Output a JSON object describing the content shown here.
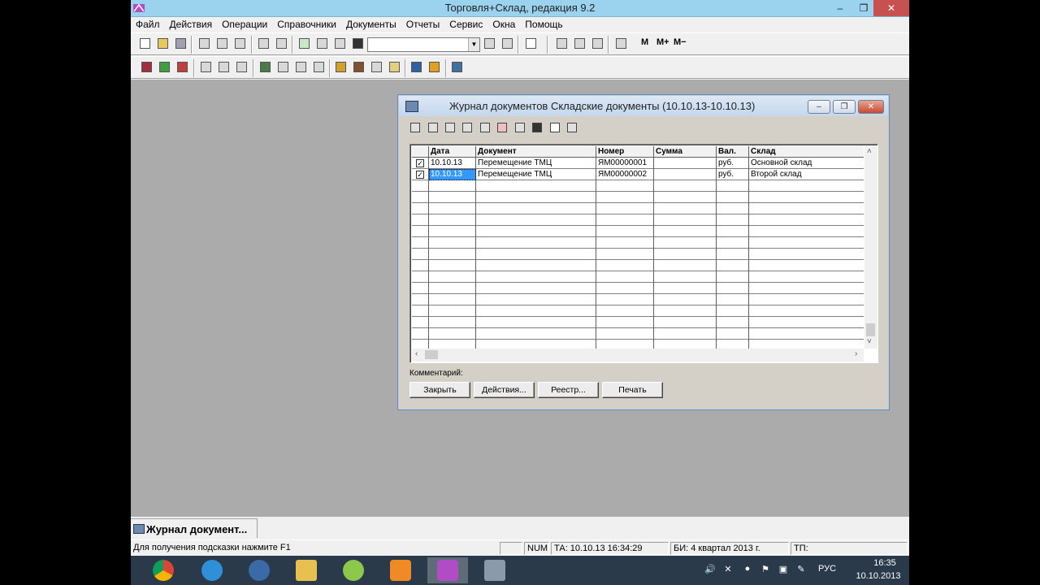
{
  "app": {
    "title": "Торговля+Склад, редакция 9.2",
    "window_controls": {
      "minimize": "–",
      "maximize": "❐",
      "close": "✕"
    }
  },
  "menu": [
    "Файл",
    "Действия",
    "Операции",
    "Справочники",
    "Документы",
    "Отчеты",
    "Сервис",
    "Окна",
    "Помощь"
  ],
  "toolbar": {
    "combo_value": "",
    "memory_buttons": [
      "M",
      "M+",
      "M−"
    ]
  },
  "journal": {
    "title": "Журнал документов  Складские документы (10.10.13-10.10.13)",
    "columns": [
      "",
      "Дата",
      "Документ",
      "Номер",
      "Сумма",
      "Вал.",
      "Склад"
    ],
    "rows": [
      {
        "checked": "✓",
        "date": "10.10.13",
        "doc": "Перемещение ТМЦ",
        "number": "ЯМ00000001",
        "sum": "",
        "cur": "руб.",
        "wh": "Основной склад"
      },
      {
        "checked": "✓",
        "date": "10.10.13",
        "doc": "Перемещение ТМЦ",
        "number": "ЯМ00000002",
        "sum": "",
        "cur": "руб.",
        "wh": "Второй склад"
      }
    ],
    "comment_label": "Комментарий:",
    "buttons": [
      "Закрыть",
      "Действия...",
      "Реестр...",
      "Печать"
    ],
    "scroll_arrows": {
      "up": "˄",
      "down": "˅",
      "left": "‹",
      "right": "›"
    }
  },
  "taskitem": {
    "label": "Журнал документ..."
  },
  "status": {
    "hint": "Для получения подсказки нажмите F1",
    "num": "NUM",
    "ta": "ТА: 10.10.13  16:34:29",
    "bi": "БИ: 4 квартал 2013 г.",
    "tp": "ТП:"
  },
  "taskbar": {
    "lang": "РУС",
    "time": "16:35",
    "date": "10.10.2013"
  },
  "colors": {
    "accent": "#3399ff",
    "mdi_bg": "#ababab",
    "titlebar": "#9bd3ef"
  }
}
